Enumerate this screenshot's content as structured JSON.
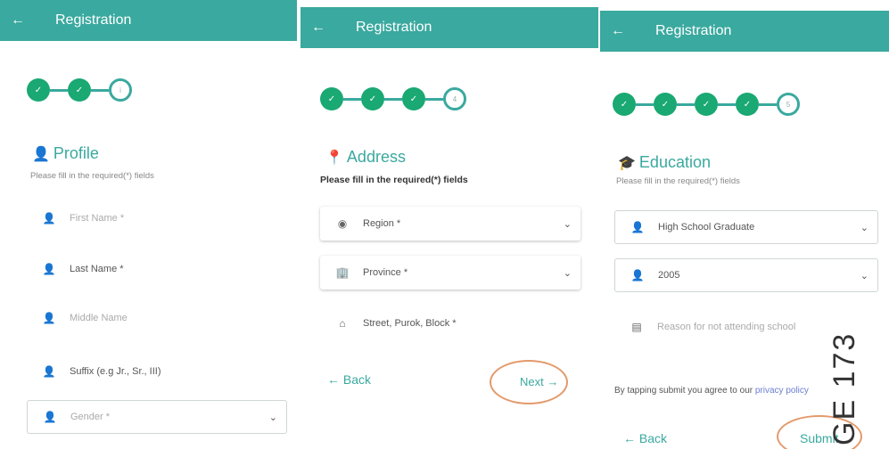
{
  "panels": [
    {
      "title": "Registration",
      "back_icon": "arrow-left-icon",
      "steps": [
        "✓",
        "✓",
        "i"
      ],
      "section_icon": "user-icon",
      "section_title": "Profile",
      "subtitle": "Please fill in the required(*) fields",
      "fields": [
        {
          "label": "First Name *",
          "placeholder": true
        },
        {
          "label": "Last Name *",
          "placeholder": false
        },
        {
          "label": "Middle Name",
          "placeholder": true
        },
        {
          "label": "Suffix (e.g Jr., Sr., III)",
          "placeholder": false
        },
        {
          "label": "Gender *",
          "placeholder": true
        }
      ]
    },
    {
      "title": "Registration",
      "steps": [
        "✓",
        "✓",
        "✓",
        "4"
      ],
      "section_title": "Address",
      "subtitle": "Please fill in the required(*) fields",
      "fields": [
        {
          "label": "Region *"
        },
        {
          "label": "Province *"
        },
        {
          "label": "Street, Purok, Block *"
        }
      ],
      "back_label": "← Back",
      "next_label": "Next →"
    },
    {
      "title": "Registration",
      "steps": [
        "✓",
        "✓",
        "✓",
        "✓",
        "5"
      ],
      "section_title": "Education",
      "subtitle": "Please fill in the required(*) fields",
      "fields": [
        {
          "label": "High School Graduate"
        },
        {
          "label": "2005"
        },
        {
          "label": "Reason for not attending school"
        }
      ],
      "terms_prefix": "By tapping submit you agree to our ",
      "terms_link": "privacy policy",
      "back_label": "← Back",
      "submit_label": "Submit"
    }
  ],
  "stamp_text": "GE 173",
  "colors": {
    "appbar": "#3aa99f",
    "step_done": "#1aa873",
    "oval": "#e39a6c"
  }
}
